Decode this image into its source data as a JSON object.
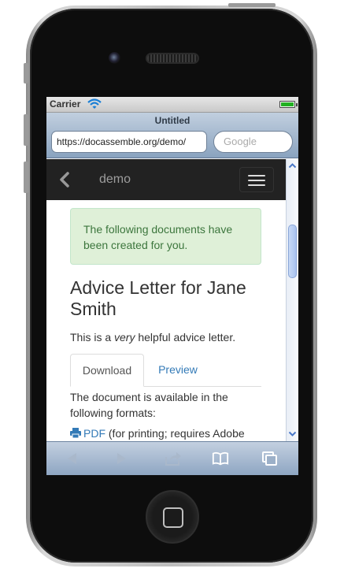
{
  "status_bar": {
    "carrier": "Carrier"
  },
  "browser": {
    "title": "Untitled",
    "url": "https://docassemble.org/demo/",
    "search_placeholder": "Google"
  },
  "navbar": {
    "brand": "demo"
  },
  "page": {
    "alert": "The following documents have been created for you.",
    "heading": "Advice Letter for Jane Smith",
    "intro_prefix": "This is a ",
    "intro_emphasis": "very",
    "intro_suffix": " helpful advice letter.",
    "tabs": [
      {
        "label": "Download",
        "active": true
      },
      {
        "label": "Preview",
        "active": false
      }
    ],
    "formats_text": "The document is available in the following formats:",
    "pdf_link": "PDF",
    "pdf_note": " (for printing; requires Adobe"
  },
  "toolbar": {
    "icons": [
      "back-icon",
      "forward-icon",
      "share-icon",
      "bookmarks-icon",
      "pages-icon"
    ]
  },
  "colors": {
    "navbar_bg": "#222222",
    "alert_bg": "#dff0d8",
    "alert_text": "#3c763d",
    "link": "#337ab7",
    "battery": "#22b022",
    "wifi": "#1a7fd6"
  }
}
